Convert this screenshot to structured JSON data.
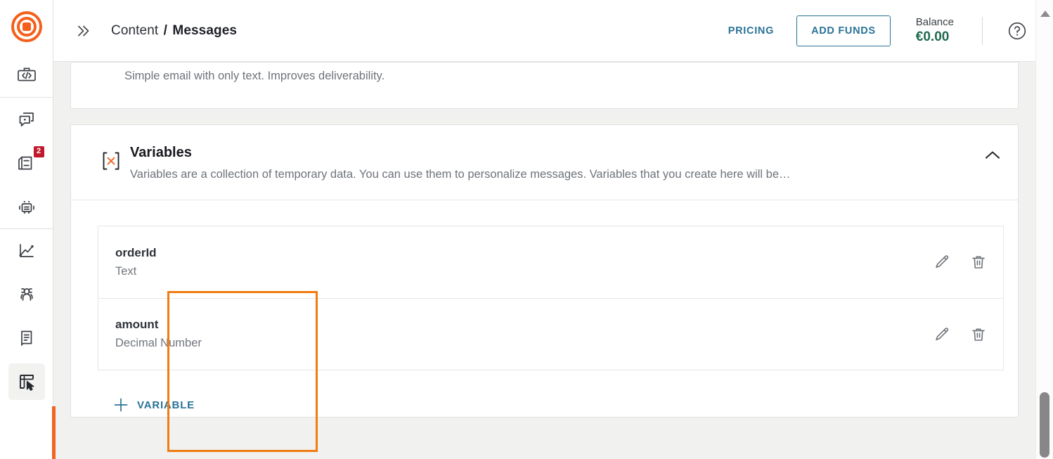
{
  "brand": {
    "logo_icon": "target-logo-icon",
    "accent_color": "#f26322",
    "link_color": "#2a7397",
    "balance_color": "#1f6b4f",
    "highlight_color": "#f07c14"
  },
  "sidebar": {
    "items": [
      {
        "icon": "code-embed-icon",
        "label": "Developers",
        "active": false,
        "badge": null
      },
      {
        "icon": "chat-copy-icon",
        "label": "Conversations",
        "active": false,
        "badge": null
      },
      {
        "icon": "inbox-minus-icon",
        "label": "Inbox",
        "active": false,
        "badge": "2"
      },
      {
        "icon": "robot-icon",
        "label": "Bots",
        "active": false,
        "badge": null
      },
      {
        "icon": "analytics-chart-icon",
        "label": "Analytics",
        "active": false,
        "badge": null
      },
      {
        "icon": "people-group-icon",
        "label": "Contacts",
        "active": false,
        "badge": null
      },
      {
        "icon": "book-icon",
        "label": "Knowledge",
        "active": false,
        "badge": null
      },
      {
        "icon": "content-cursor-icon",
        "label": "Content",
        "active": true,
        "badge": null
      }
    ]
  },
  "topbar": {
    "expand_icon": "double-chevron-right-icon",
    "breadcrumb": {
      "parent": "Content",
      "separator": "/",
      "current": "Messages"
    },
    "pricing_label": "PRICING",
    "add_funds_label": "ADD FUNDS",
    "balance_label": "Balance",
    "balance_value": "€0.00",
    "help_icon": "help-circle-icon"
  },
  "top_card": {
    "subtitle": "Simple email with only text. Improves deliverability."
  },
  "variables_card": {
    "icon": "bracket-x-variable-icon",
    "title": "Variables",
    "description": "Variables are a collection of temporary data. You can use them to personalize messages. Variables that you create here will be…",
    "collapse_icon": "chevron-up-icon",
    "rows": [
      {
        "name": "orderId",
        "type": "Text",
        "edit_icon": "pencil-icon",
        "delete_icon": "trash-icon"
      },
      {
        "name": "amount",
        "type": "Decimal Number",
        "edit_icon": "pencil-icon",
        "delete_icon": "trash-icon"
      }
    ],
    "add_label": "VARIABLE",
    "add_icon": "plus-icon"
  },
  "scrollbar": {
    "up_arrow_icon": "scroll-up-arrow-icon"
  }
}
